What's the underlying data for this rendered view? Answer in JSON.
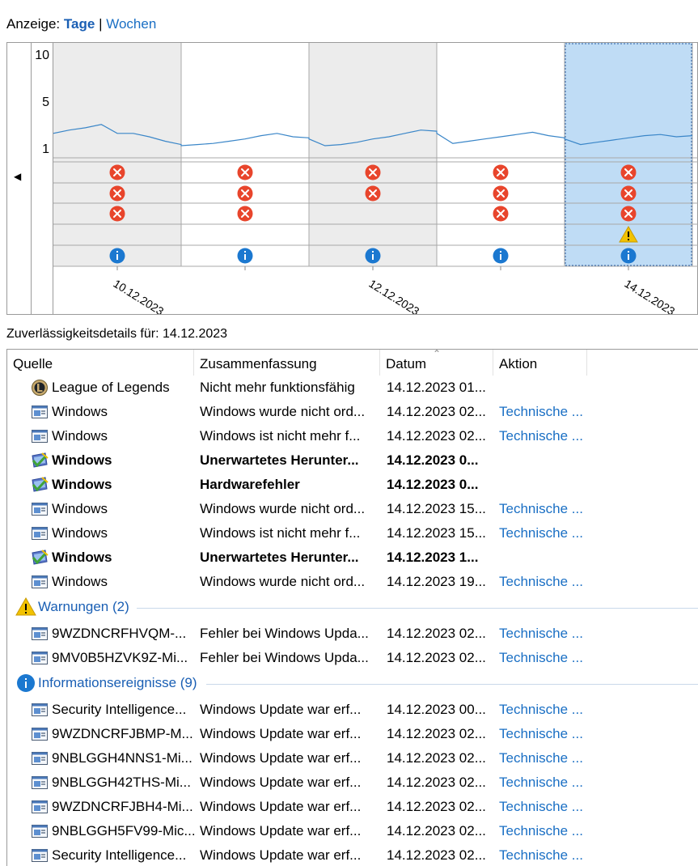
{
  "view": {
    "label": "Anzeige:",
    "days": "Tage",
    "separator": "|",
    "weeks": "Wochen"
  },
  "chart": {
    "y_ticks": [
      "10",
      "5",
      "1"
    ],
    "x_labels": [
      "10.12.2023",
      "12.12.2023",
      "14.12.2023"
    ],
    "selected_column": 4,
    "stability_index": [
      {
        "day": "10.12.2023",
        "values": [
          2.9,
          3.2,
          3.4,
          3.7,
          2.9,
          2.9,
          2.6,
          2.2,
          1.9
        ]
      },
      {
        "day": "11.12.2023",
        "values": [
          1.8,
          1.9,
          2.0,
          2.2,
          2.4,
          2.7,
          2.9,
          2.6,
          2.5
        ]
      },
      {
        "day": "12.12.2023",
        "values": [
          2.4,
          1.8,
          1.9,
          2.1,
          2.4,
          2.6,
          2.9,
          3.2,
          3.1
        ]
      },
      {
        "day": "13.12.2023",
        "values": [
          2.9,
          2.0,
          2.2,
          2.4,
          2.6,
          2.8,
          3.0,
          2.7,
          2.5
        ]
      },
      {
        "day": "14.12.2023",
        "values": [
          2.4,
          1.9,
          2.1,
          2.3,
          2.5,
          2.7,
          2.8,
          2.6,
          2.7
        ]
      }
    ],
    "event_rows": [
      [
        "error",
        "error",
        "error",
        "error",
        "error"
      ],
      [
        "error",
        "error",
        "error",
        "error",
        "error"
      ],
      [
        "error",
        "error",
        "",
        "error",
        "error"
      ],
      [
        "",
        "",
        "",
        "",
        "warning"
      ],
      [
        "info",
        "info",
        "info",
        "info",
        "info"
      ]
    ]
  },
  "details": {
    "title": "Zuverlässigkeitsdetails für: 14.12.2023"
  },
  "table": {
    "columns": [
      "Quelle",
      "Zusammenfassung",
      "Datum",
      "Aktion"
    ],
    "rows": [
      {
        "icon": "league-of-legends-icon",
        "source": "League of Legends",
        "summary": "Nicht mehr funktionsfähig",
        "date": "14.12.2023 01...",
        "action": "",
        "bold": false
      },
      {
        "icon": "window-app-icon",
        "source": "Windows",
        "summary": "Windows wurde nicht ord...",
        "date": "14.12.2023 02...",
        "action": "Technische ...",
        "bold": false
      },
      {
        "icon": "window-app-icon",
        "source": "Windows",
        "summary": "Windows ist nicht mehr f...",
        "date": "14.12.2023 02...",
        "action": "Technische ...",
        "bold": false
      },
      {
        "icon": "windows-security-icon",
        "source": "Windows",
        "summary": "Unerwartetes Herunter...",
        "date": "14.12.2023 0...",
        "action": "",
        "bold": true
      },
      {
        "icon": "windows-security-icon",
        "source": "Windows",
        "summary": "Hardwarefehler",
        "date": "14.12.2023 0...",
        "action": "",
        "bold": true
      },
      {
        "icon": "window-app-icon",
        "source": "Windows",
        "summary": "Windows wurde nicht ord...",
        "date": "14.12.2023 15...",
        "action": "Technische ...",
        "bold": false
      },
      {
        "icon": "window-app-icon",
        "source": "Windows",
        "summary": "Windows ist nicht mehr f...",
        "date": "14.12.2023 15...",
        "action": "Technische ...",
        "bold": false
      },
      {
        "icon": "windows-security-icon",
        "source": "Windows",
        "summary": "Unerwartetes Herunter...",
        "date": "14.12.2023 1...",
        "action": "",
        "bold": true
      },
      {
        "icon": "window-app-icon",
        "source": "Windows",
        "summary": "Windows wurde nicht ord...",
        "date": "14.12.2023 19...",
        "action": "Technische ...",
        "bold": false
      }
    ],
    "warnings_group": {
      "label": "Warnungen (2)",
      "rows": [
        {
          "icon": "window-app-icon",
          "source": "9WZDNCRFHVQM-...",
          "summary": "Fehler bei Windows Upda...",
          "date": "14.12.2023 02...",
          "action": "Technische ..."
        },
        {
          "icon": "window-app-icon",
          "source": "9MV0B5HZVK9Z-Mi...",
          "summary": "Fehler bei Windows Upda...",
          "date": "14.12.2023 02...",
          "action": "Technische ..."
        }
      ]
    },
    "info_group": {
      "label": "Informationsereignisse (9)",
      "rows": [
        {
          "icon": "window-app-icon",
          "source": "Security Intelligence...",
          "summary": "Windows Update war erf...",
          "date": "14.12.2023 00...",
          "action": "Technische ..."
        },
        {
          "icon": "window-app-icon",
          "source": "9WZDNCRFJBMP-M...",
          "summary": "Windows Update war erf...",
          "date": "14.12.2023 02...",
          "action": "Technische ..."
        },
        {
          "icon": "window-app-icon",
          "source": "9NBLGGH4NNS1-Mi...",
          "summary": "Windows Update war erf...",
          "date": "14.12.2023 02...",
          "action": "Technische ..."
        },
        {
          "icon": "window-app-icon",
          "source": "9NBLGGH42THS-Mi...",
          "summary": "Windows Update war erf...",
          "date": "14.12.2023 02...",
          "action": "Technische ..."
        },
        {
          "icon": "window-app-icon",
          "source": "9WZDNCRFJBH4-Mi...",
          "summary": "Windows Update war erf...",
          "date": "14.12.2023 02...",
          "action": "Technische ..."
        },
        {
          "icon": "window-app-icon",
          "source": "9NBLGGH5FV99-Mic...",
          "summary": "Windows Update war erf...",
          "date": "14.12.2023 02...",
          "action": "Technische ..."
        },
        {
          "icon": "window-app-icon",
          "source": "Security Intelligence...",
          "summary": "Windows Update war erf...",
          "date": "14.12.2023 02...",
          "action": "Technische ..."
        }
      ]
    }
  },
  "colors": {
    "accent": "#1a6fc4",
    "selection": "#bfdcf5",
    "error": "#e8452c",
    "warning": "#f2c200",
    "info": "#1b78d0"
  }
}
